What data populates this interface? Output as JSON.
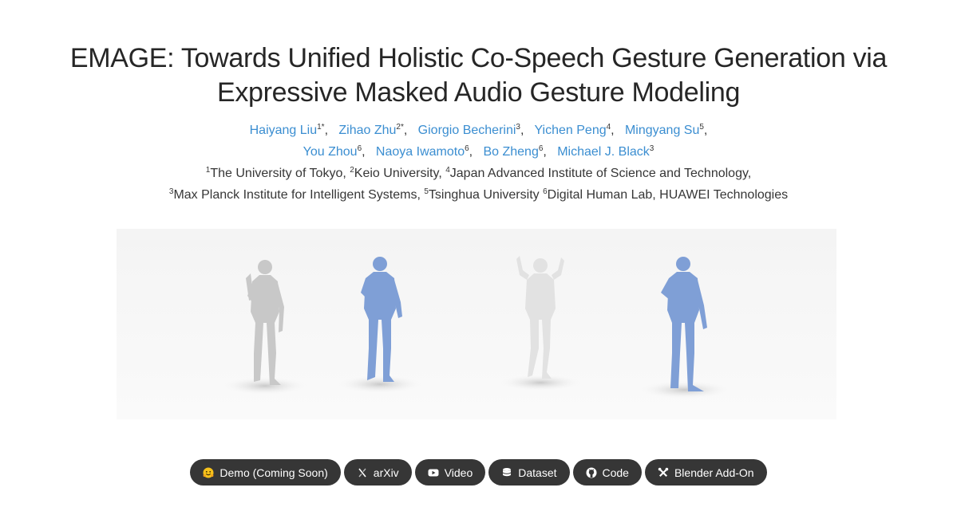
{
  "title": {
    "line1": "EMAGE: Towards Unified Holistic Co-Speech Gesture Generation via",
    "line2": "Expressive Masked Audio Gesture Modeling"
  },
  "authors": [
    {
      "name": "Haiyang Liu",
      "sup": "1*"
    },
    {
      "name": "Zihao Zhu",
      "sup": "2*"
    },
    {
      "name": "Giorgio Becherini",
      "sup": "3"
    },
    {
      "name": "Yichen Peng",
      "sup": "4"
    },
    {
      "name": "Mingyang Su",
      "sup": "5"
    },
    {
      "name": "You Zhou",
      "sup": "6"
    },
    {
      "name": "Naoya Iwamoto",
      "sup": "6"
    },
    {
      "name": "Bo Zheng",
      "sup": "6"
    },
    {
      "name": "Michael J. Black",
      "sup": "3"
    }
  ],
  "affiliations": [
    {
      "sup": "1",
      "text": "The University of Tokyo, "
    },
    {
      "sup": "2",
      "text": "Keio University, "
    },
    {
      "sup": "4",
      "text": "Japan Advanced Institute of Science and Technology,"
    },
    {
      "sup": "3",
      "text": "Max Planck Institute for Intelligent Systems, "
    },
    {
      "sup": "5",
      "text": "Tsinghua University "
    },
    {
      "sup": "6",
      "text": "Digital Human Lab, HUAWEI Technologies"
    }
  ],
  "teaser": {
    "figures": [
      {
        "color": "#c8c8c8",
        "pose": "one-hand-raised"
      },
      {
        "color": "#7f9fd6",
        "pose": "hand-at-chest"
      },
      {
        "color": "#e2e2e2",
        "pose": "both-hands-raised"
      },
      {
        "color": "#7f9fd6",
        "pose": "hand-at-chest"
      }
    ]
  },
  "buttons": [
    {
      "label": "Demo (Coming Soon)",
      "icon": "hugging-face-icon"
    },
    {
      "label": "arXiv",
      "icon": "arxiv-icon"
    },
    {
      "label": "Video",
      "icon": "youtube-icon"
    },
    {
      "label": "Dataset",
      "icon": "database-icon"
    },
    {
      "label": "Code",
      "icon": "github-icon"
    },
    {
      "label": "Blender Add-On",
      "icon": "tools-icon"
    }
  ],
  "colors": {
    "link": "#3b8ed1",
    "text": "#363636",
    "button_bg": "#363636",
    "body_blue": "#7f9fd6"
  }
}
